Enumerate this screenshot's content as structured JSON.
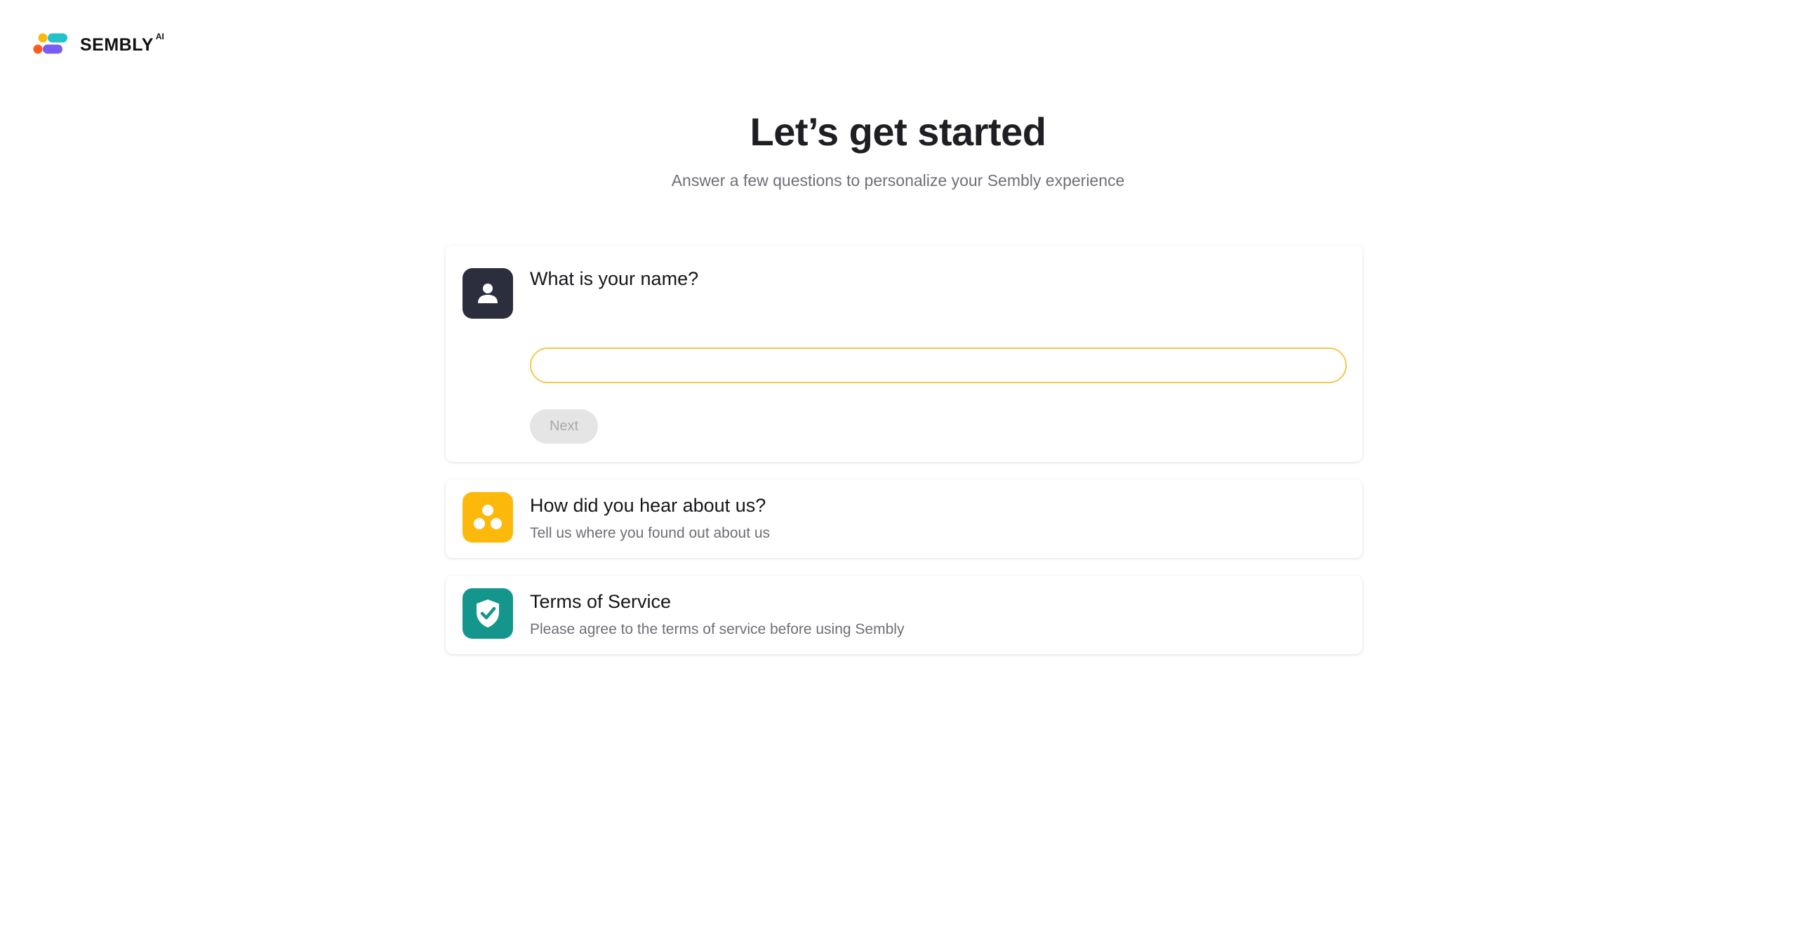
{
  "brand": {
    "name": "SEMBLY",
    "suffix": "AI",
    "colors": {
      "dot_yellow": "#fdb90b",
      "dot_teal": "#22c2c9",
      "dot_orange": "#ff5a1f",
      "dot_purple": "#7a5cf5"
    }
  },
  "header": {
    "title": "Let’s get started",
    "subtitle": "Answer a few questions to personalize your Sembly experience"
  },
  "steps": [
    {
      "title": "What is your name?",
      "icon": "user-icon",
      "icon_bg": "#2b2e3d",
      "input": {
        "value": "",
        "placeholder": ""
      },
      "next_label": "Next",
      "next_disabled": true
    },
    {
      "title": "How did you hear about us?",
      "description": "Tell us where you found out about us",
      "icon": "community-icon",
      "icon_bg": "#fdb90b"
    },
    {
      "title": "Terms of Service",
      "description": "Please agree to the terms of service before using Sembly",
      "icon": "shield-check-icon",
      "icon_bg": "#14968c"
    }
  ]
}
